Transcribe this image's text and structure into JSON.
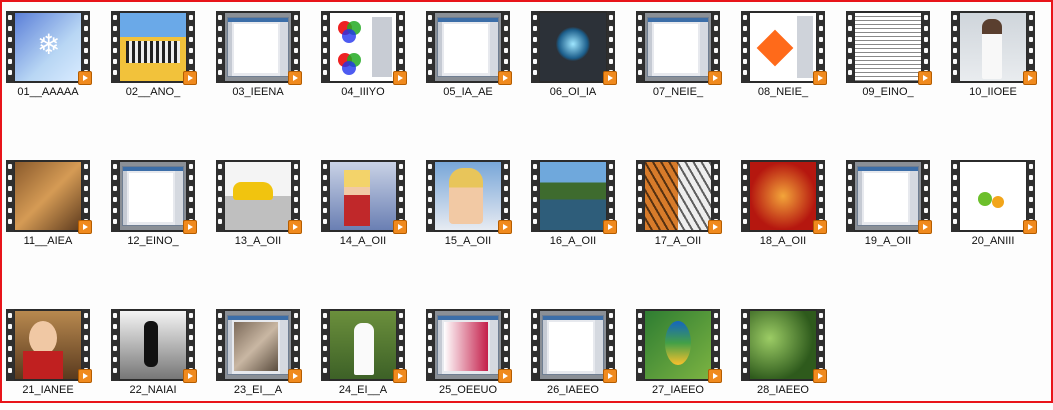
{
  "files": [
    {
      "name": "01__AAAAA",
      "thumb": "snowflake-blue"
    },
    {
      "name": "02__ANO_",
      "thumb": "zebras-yellow"
    },
    {
      "name": "03_IEENA",
      "thumb": "app-window"
    },
    {
      "name": "04_IIIYO",
      "thumb": "rgb-circles"
    },
    {
      "name": "05_IA_AE",
      "thumb": "app-window"
    },
    {
      "name": "06_OI_IA",
      "thumb": "dark-glow"
    },
    {
      "name": "07_NEIE_",
      "thumb": "app-window"
    },
    {
      "name": "08_NEIE_",
      "thumb": "orange-shape"
    },
    {
      "name": "09_EINO_",
      "thumb": "text-doc"
    },
    {
      "name": "10_IIOEE",
      "thumb": "bride-photo"
    },
    {
      "name": "11__AIEA",
      "thumb": "cougar"
    },
    {
      "name": "12_EINO_",
      "thumb": "app-window"
    },
    {
      "name": "13_A_OII",
      "thumb": "yellow-car"
    },
    {
      "name": "14_A_OII",
      "thumb": "athlete-woman"
    },
    {
      "name": "15_A_OII",
      "thumb": "athlete-portrait"
    },
    {
      "name": "16_A_OII",
      "thumb": "mountain-lake"
    },
    {
      "name": "17_A_OII",
      "thumb": "tigers"
    },
    {
      "name": "18_A_OII",
      "thumb": "fruit-splash"
    },
    {
      "name": "19_A_OII",
      "thumb": "app-window"
    },
    {
      "name": "20_ANIII",
      "thumb": "fruit-white"
    },
    {
      "name": "21_IANEE",
      "thumb": "boy-photo"
    },
    {
      "name": "22_NAIAI",
      "thumb": "bw-figure"
    },
    {
      "name": "23_EI__A",
      "thumb": "app-photo"
    },
    {
      "name": "24_EI__A",
      "thumb": "wedding-garden"
    },
    {
      "name": "25_OEEUO",
      "thumb": "color-picker"
    },
    {
      "name": "26_IAEEO",
      "thumb": "app-window"
    },
    {
      "name": "27_IAEEO",
      "thumb": "parrot"
    },
    {
      "name": "28_IAEEO",
      "thumb": "green-foliage"
    }
  ]
}
